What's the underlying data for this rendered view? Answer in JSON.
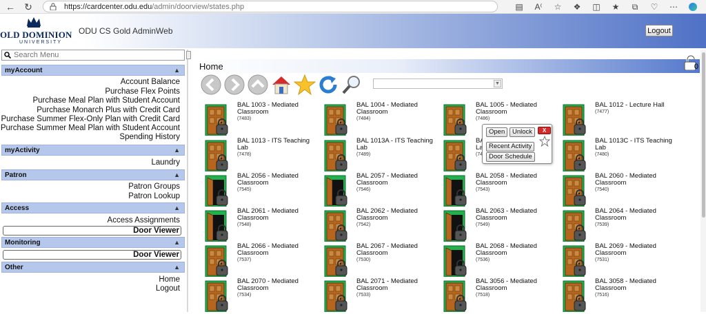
{
  "browser": {
    "url_host": "https://cardcenter.odu.edu",
    "url_path": "/admin/doorview/states.php"
  },
  "header": {
    "logo_text": "OLD DOMINION",
    "logo_sub": "UNIVERSITY",
    "app_title": "ODU CS Gold AdminWeb",
    "logout_label": "Logout"
  },
  "sidebar": {
    "search_placeholder": "Search Menu",
    "sections": [
      {
        "title": "myAccount",
        "items": [
          "Account Balance",
          "Purchase Flex Points",
          "Purchase Meal Plan with Student Account",
          "Purchase Monarch Plus with Credit Card",
          "Purchase Summer Flex-Only Plan with Credit Card",
          "Purchase Summer Meal Plan with Student Account",
          "Spending History"
        ]
      },
      {
        "title": "myActivity",
        "items": [
          "Laundry"
        ]
      },
      {
        "title": "Patron",
        "items": [
          "Patron Groups",
          "Patron Lookup"
        ]
      },
      {
        "title": "Access",
        "items": [
          "Access Assignments",
          "Door Viewer"
        ]
      },
      {
        "title": "Monitoring",
        "items": [
          "Door Viewer"
        ]
      },
      {
        "title": "Other",
        "items": [
          "Home",
          "Logout"
        ]
      }
    ]
  },
  "main": {
    "title": "Home",
    "lock_count": "0"
  },
  "doors": [
    {
      "name": "BAL 1003 - Mediated Classroom",
      "id": "(7483)",
      "state": "closed"
    },
    {
      "name": "BAL 1004 - Mediated Classroom",
      "id": "(7484)",
      "state": "closed"
    },
    {
      "name": "BAL 1005 - Mediated Classroom",
      "id": "(7486)",
      "state": "closed"
    },
    {
      "name": "BAL 1012 - Lecture Hall",
      "id": "(7477)",
      "state": "closed"
    },
    {
      "name": "BAL 1013 - ITS Teaching Lab",
      "id": "(7478)",
      "state": "closed"
    },
    {
      "name": "BAL 1013A - ITS Teaching Lab",
      "id": "(7489)",
      "state": "closed"
    },
    {
      "name": "BAL 1013B - ITS Teaching Lab",
      "id": "(7479)",
      "state": "closed"
    },
    {
      "name": "BAL 1013C - ITS Teaching Lab",
      "id": "(7480)",
      "state": "closed"
    },
    {
      "name": "BAL 2056 - Mediated Classroom",
      "id": "(7545)",
      "state": "open"
    },
    {
      "name": "BAL 2057 - Mediated Classroom",
      "id": "(7546)",
      "state": "open"
    },
    {
      "name": "BAL 2058 - Mediated Classroom",
      "id": "(7543)",
      "state": "open"
    },
    {
      "name": "BAL 2060 - Mediated Classroom",
      "id": "(7540)",
      "state": "closed"
    },
    {
      "name": "BAL 2061 - Mediated Classroom",
      "id": "(7548)",
      "state": "open"
    },
    {
      "name": "BAL 2062 - Mediated Classroom",
      "id": "(7542)",
      "state": "closed"
    },
    {
      "name": "BAL 2063 - Mediated Classroom",
      "id": "(7549)",
      "state": "open"
    },
    {
      "name": "BAL 2064 - Mediated Classroom",
      "id": "(7539)",
      "state": "closed"
    },
    {
      "name": "BAL 2066 - Mediated Classroom",
      "id": "(7537)",
      "state": "closed"
    },
    {
      "name": "BAL 2067 - Mediated Classroom",
      "id": "(7530)",
      "state": "closed"
    },
    {
      "name": "BAL 2068 - Mediated Classroom",
      "id": "(7536)",
      "state": "open"
    },
    {
      "name": "BAL 2069 - Mediated Classroom",
      "id": "(7531)",
      "state": "closed"
    },
    {
      "name": "BAL 2070 - Mediated Classroom",
      "id": "(7534)",
      "state": "closed"
    },
    {
      "name": "BAL 2071 - Mediated Classroom",
      "id": "(7533)",
      "state": "closed"
    },
    {
      "name": "BAL 3056 - Mediated Classroom",
      "id": "(7518)",
      "state": "closed"
    },
    {
      "name": "BAL 3058 - Mediated Classroom",
      "id": "(7516)",
      "state": "closed"
    }
  ],
  "popup": {
    "open_label": "Open",
    "unlock_label": "Unlock",
    "close_label": "X",
    "recent_activity_label": "Recent Activity",
    "door_schedule_label": "Door Schedule"
  },
  "colors": {
    "section_bg": "#b5c7ea",
    "header_blue": "#4f71c6",
    "door_frame": "#22b14c",
    "door_wood": "#b5651d"
  }
}
